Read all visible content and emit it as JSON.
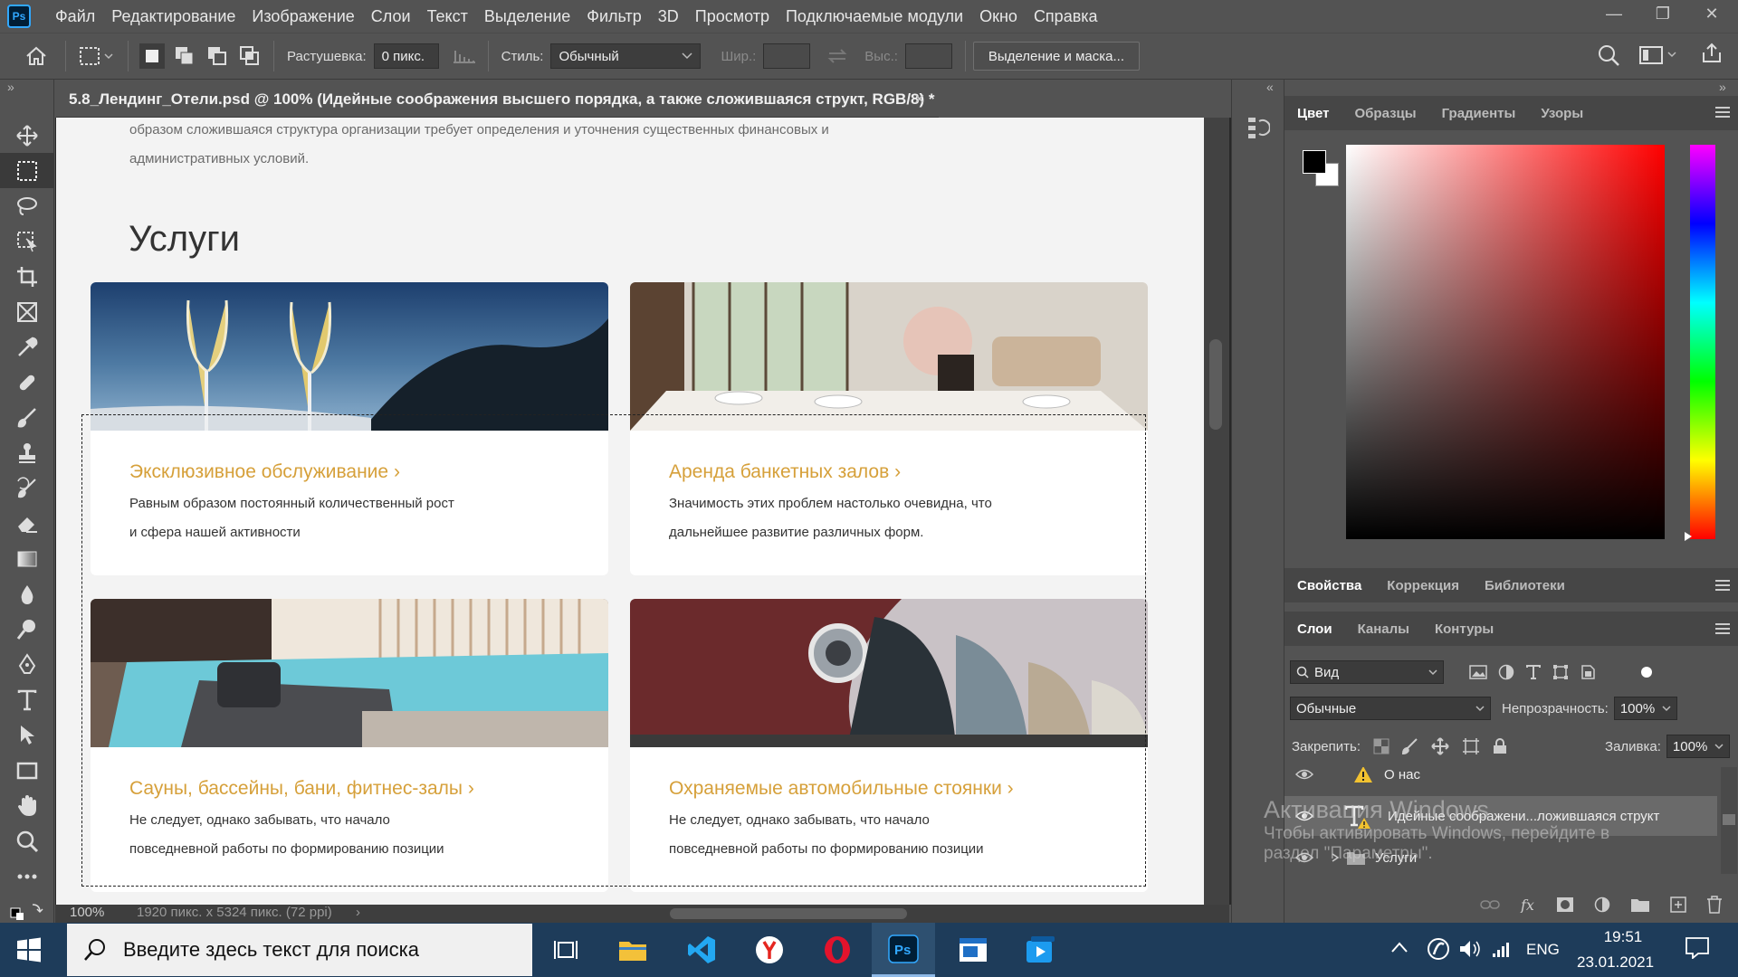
{
  "app": {
    "logo": "Ps"
  },
  "menu": [
    "Файл",
    "Редактирование",
    "Изображение",
    "Слои",
    "Текст",
    "Выделение",
    "Фильтр",
    "3D",
    "Просмотр",
    "Подключаемые модули",
    "Окно",
    "Справка"
  ],
  "window_controls": {
    "minimize": "—",
    "restore": "❐",
    "close": "✕"
  },
  "options": {
    "feather_label": "Растушевка:",
    "feather_value": "0 пикс.",
    "style_label": "Стиль:",
    "style_value": "Обычный",
    "width_label": "Шир.:",
    "height_label": "Выс.:",
    "select_mask": "Выделение и маска..."
  },
  "tab_collapse": "»",
  "document": {
    "tab_title": "5.8_Лендинг_Отели.psd @ 100% (Идейные соображения высшего порядка, а также сложившаяся структ, RGB/8) *",
    "close": "×",
    "intro_line1": "образом сложившаяся структура организации требует определения и уточнения существенных финансовых и",
    "intro_line2": "административных условий.",
    "heading": "Услуги",
    "cards": [
      {
        "title": "Эксклюзивное обслуживание",
        "line1": "Равным образом постоянный количественный рост",
        "line2": "и сфера нашей активности"
      },
      {
        "title": "Аренда банкетных залов",
        "line1": "Значимость этих проблем настолько очевидна, что",
        "line2": "дальнейшее развитие различных форм."
      },
      {
        "title": "Сауны, бассейны, бани, фитнес-залы",
        "line1": "Не следует, однако забывать, что начало",
        "line2": "повседневной работы по формированию позиции"
      },
      {
        "title": "Охраняемые автомобильные стоянки",
        "line1": "Не следует, однако забывать, что начало",
        "line2": "повседневной работы по формированию позиции"
      }
    ],
    "chevron": "›"
  },
  "status": {
    "zoom": "100%",
    "doc_info": "1920 пикс. x 5324 пикс. (72 ppi)",
    "arrow": "›"
  },
  "panel_collapse": "«",
  "color_panel": {
    "tabs": [
      "Цвет",
      "Образцы",
      "Градиенты",
      "Узоры"
    ],
    "foreground": "#000000",
    "background": "#ffffff",
    "hue": "#ff0000"
  },
  "props_panel": {
    "tabs": [
      "Свойства",
      "Коррекция",
      "Библиотеки"
    ]
  },
  "layers_panel": {
    "tabs": [
      "Слои",
      "Каналы",
      "Контуры"
    ],
    "filter_kind": "Вид",
    "blend_mode": "Обычные",
    "opacity_label": "Непрозрачность:",
    "opacity_value": "100%",
    "lock_label": "Закрепить:",
    "fill_label": "Заливка:",
    "fill_value": "100%",
    "layers": [
      {
        "name": "О нас"
      },
      {
        "name": "Идейные соображени...ложившаяся структ"
      },
      {
        "name": "Услуги"
      }
    ],
    "footer_icons": [
      "link-icon",
      "fx-icon",
      "mask-icon",
      "adjustment-icon",
      "folder-icon",
      "new-layer-icon",
      "trash-icon"
    ]
  },
  "watermark": {
    "line1": "Активация Windows",
    "line2": "Чтобы активировать Windows, перейдите в",
    "line3": "раздел \"Параметры\"."
  },
  "taskbar": {
    "search_placeholder": "Введите здесь текст для поиска",
    "language": "ENG",
    "time": "19:51",
    "date": "23.01.2021"
  }
}
